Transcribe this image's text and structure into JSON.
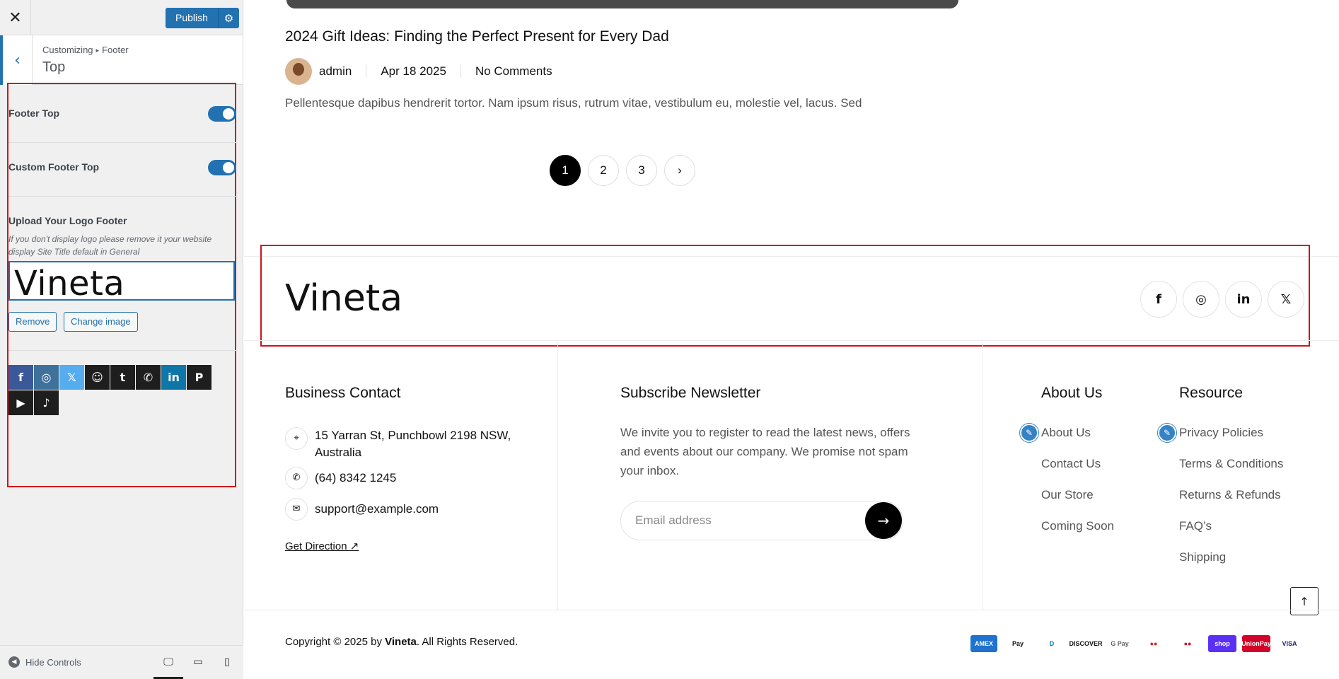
{
  "customizer": {
    "close_glyph": "✕",
    "publish_label": "Publish",
    "gear_glyph": "⚙",
    "back_glyph": "‹",
    "crumb_root": "Customizing",
    "crumb_arrow": "▸",
    "crumb_section": "Footer",
    "title": "Top",
    "footer_top_label": "Footer Top",
    "custom_footer_top_label": "Custom Footer Top",
    "upload_label": "Upload Your Logo Footer",
    "upload_desc": "If you don't display logo please remove it your website display Site Title default in General",
    "logo_preview": "Vineta",
    "remove_label": "Remove",
    "change_label": "Change image",
    "hide_controls": "Hide Controls",
    "hide_glyph": "◀",
    "socials": [
      {
        "glyph": "f",
        "color": "#3b5998"
      },
      {
        "glyph": "◎",
        "color": "#3f729b"
      },
      {
        "glyph": "𝕏",
        "color": "#55acee"
      },
      {
        "glyph": "☺",
        "color": "#1e1e1e"
      },
      {
        "glyph": "t",
        "color": "#1e1e1e"
      },
      {
        "glyph": "✆",
        "color": "#1e1e1e"
      },
      {
        "glyph": "in",
        "color": "#0e76a8"
      },
      {
        "glyph": "P",
        "color": "#1e1e1e"
      },
      {
        "glyph": "▶",
        "color": "#1e1e1e"
      },
      {
        "glyph": "♪",
        "color": "#1e1e1e"
      }
    ],
    "devices": {
      "desktop": "🖵",
      "tablet": "▭",
      "mobile": "▯"
    }
  },
  "post": {
    "title": "2024 Gift Ideas: Finding the Perfect Present for Every Dad",
    "author": "admin",
    "date": "Apr 18 2025",
    "comments": "No Comments",
    "excerpt": "Pellentesque dapibus hendrerit tortor. Nam ipsum risus, rutrum vitae, vestibulum eu, molestie vel, lacus. Sed"
  },
  "pagination": {
    "pages": [
      "1",
      "2",
      "3"
    ],
    "next_glyph": "›"
  },
  "footer_top": {
    "logo": "Vineta",
    "social_glyphs": {
      "facebook": "f",
      "instagram": "◎",
      "linkedin": "in",
      "x": "𝕏"
    }
  },
  "business": {
    "heading": "Business Contact",
    "address": "15 Yarran St, Punchbowl 2198 NSW, Australia",
    "phone": "(64) 8342 1245",
    "email": "support@example.com",
    "direction": "Get Direction ↗",
    "icons": {
      "pin": "⌖",
      "phone": "✆",
      "mail": "✉"
    }
  },
  "newsletter": {
    "heading": "Subscribe Newsletter",
    "text": "We invite you to register to read the latest news, offers and events about our company. We promise not spam your inbox.",
    "placeholder": "Email address",
    "send_glyph": "→"
  },
  "about": {
    "heading": "About Us",
    "links": [
      "About Us",
      "Contact Us",
      "Our Store",
      "Coming Soon"
    ]
  },
  "resource": {
    "heading": "Resource",
    "links": [
      "Privacy Policies",
      "Terms & Conditions",
      "Returns & Refunds",
      "FAQ’s",
      "Shipping"
    ]
  },
  "edit_glyph": "✎",
  "back_top_glyph": "↑",
  "copyright": {
    "prefix": "Copyright © 2025 by ",
    "brand": "Vineta",
    "suffix": ". All Rights Reserved."
  },
  "payments": [
    {
      "label": "AMEX",
      "bg": "#1f72cd",
      "fg": "#ffffff"
    },
    {
      "label": "Pay",
      "bg": "#ffffff",
      "fg": "#111111"
    },
    {
      "label": "D",
      "bg": "#ffffff",
      "fg": "#0079be"
    },
    {
      "label": "DISCOVER",
      "bg": "#ffffff",
      "fg": "#111111"
    },
    {
      "label": "G Pay",
      "bg": "#ffffff",
      "fg": "#5f6368"
    },
    {
      "label": "●●",
      "bg": "#ffffff",
      "fg": "#e11b22"
    },
    {
      "label": "●●",
      "bg": "#ffffff",
      "fg": "#eb001b"
    },
    {
      "label": "shop",
      "bg": "#5a31f4",
      "fg": "#ffffff"
    },
    {
      "label": "UnionPay",
      "bg": "#d10429",
      "fg": "#ffffff"
    },
    {
      "label": "VISA",
      "bg": "#ffffff",
      "fg": "#1a1f71"
    }
  ]
}
